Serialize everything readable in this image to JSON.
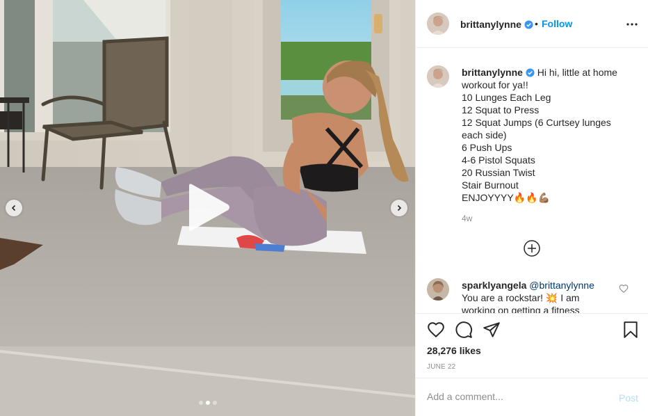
{
  "post": {
    "username": "brittanylynne",
    "follow_label": "Follow",
    "bullet": "•",
    "caption_lines": [
      "Hi hi, little at home",
      "workout for ya!!",
      "10 Lunges Each Leg",
      "12 Squat to Press",
      "12 Squat Jumps (6 Curtsey lunges",
      "each side)",
      "6 Push Ups",
      "4-6 Pistol Squats",
      "20 Russian Twist",
      "Stair Burnout",
      "ENJOYYYY🔥🔥💪🏽"
    ],
    "time_ago": "4w",
    "comment": {
      "username": "sparklyangela",
      "mention": "@brittanylynne",
      "text_line1": "You are a rockstar! 💥 I am",
      "text_line2": "working on getting a fitness"
    },
    "likes": "28,276 likes",
    "date": "JUNE 22",
    "comment_placeholder": "Add a comment...",
    "post_label": "Post"
  },
  "carousel": {
    "slide_count": 3,
    "active_index": 1
  },
  "colors": {
    "accent": "#0095f6",
    "verified": "#3897f0",
    "post_disabled": "#b2dffc",
    "muted": "#8e8e8e"
  },
  "icons": [
    "verified-badge-icon",
    "more-options-icon",
    "play-icon",
    "chevron-left-icon",
    "chevron-right-icon",
    "add-circle-icon",
    "heart-icon",
    "comment-icon",
    "share-icon",
    "bookmark-icon"
  ]
}
